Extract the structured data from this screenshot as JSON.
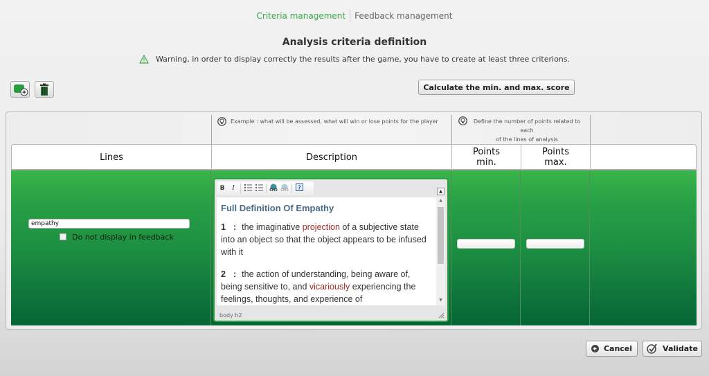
{
  "nav": {
    "tabs": [
      {
        "label": "Criteria management",
        "active": true
      },
      {
        "label": "Feedback management",
        "active": false
      }
    ]
  },
  "header": {
    "title": "Analysis criteria definition",
    "warning": "Warning, in order to display correctly the results after the game, you have to create at least three criterions."
  },
  "toolbar": {
    "add_icon": "add-line-icon",
    "delete_icon": "trash-icon",
    "calculate_label": "Calculate the min. and max. score"
  },
  "hints": {
    "description": "Example : what will be assessed, what will win or lose points for the player",
    "points_line1": "Define the number of points related to each",
    "points_line2": "of the lines of analysis"
  },
  "table": {
    "columns": {
      "lines": "Lines",
      "description": "Description",
      "points_min_1": "Points",
      "points_min_2": "min.",
      "points_max_1": "Points",
      "points_max_2": "max."
    },
    "row": {
      "line_value": "empathy",
      "hide_feedback_label": "Do not display in feedback",
      "hide_feedback_checked": false,
      "points_min": "",
      "points_max": ""
    }
  },
  "editor": {
    "buttons": [
      "B",
      "I",
      "ordered-list",
      "unordered-list",
      "link",
      "unlink",
      "help"
    ],
    "heading": "Full Definition Of Empathy",
    "definitions": [
      {
        "num": "1",
        "before": "the imaginative ",
        "highlight": "projection",
        "after": " of a subjective state into an object so that the object appears to be infused with it"
      },
      {
        "num": "2",
        "before": "the action of understanding, being aware of, being sensitive to, and ",
        "highlight": "vicariously",
        "after": " experiencing the feelings, thoughts, and experience of"
      }
    ],
    "status_path": "body  h2",
    "accent_color": "#2f9e44"
  },
  "footer": {
    "cancel_label": "Cancel",
    "validate_label": "Validate"
  },
  "colors": {
    "accent_green": "#3ca64a",
    "row_gradient_top": "#3ab54a",
    "row_gradient_bottom": "#056535",
    "link_red": "#a52a2a"
  }
}
